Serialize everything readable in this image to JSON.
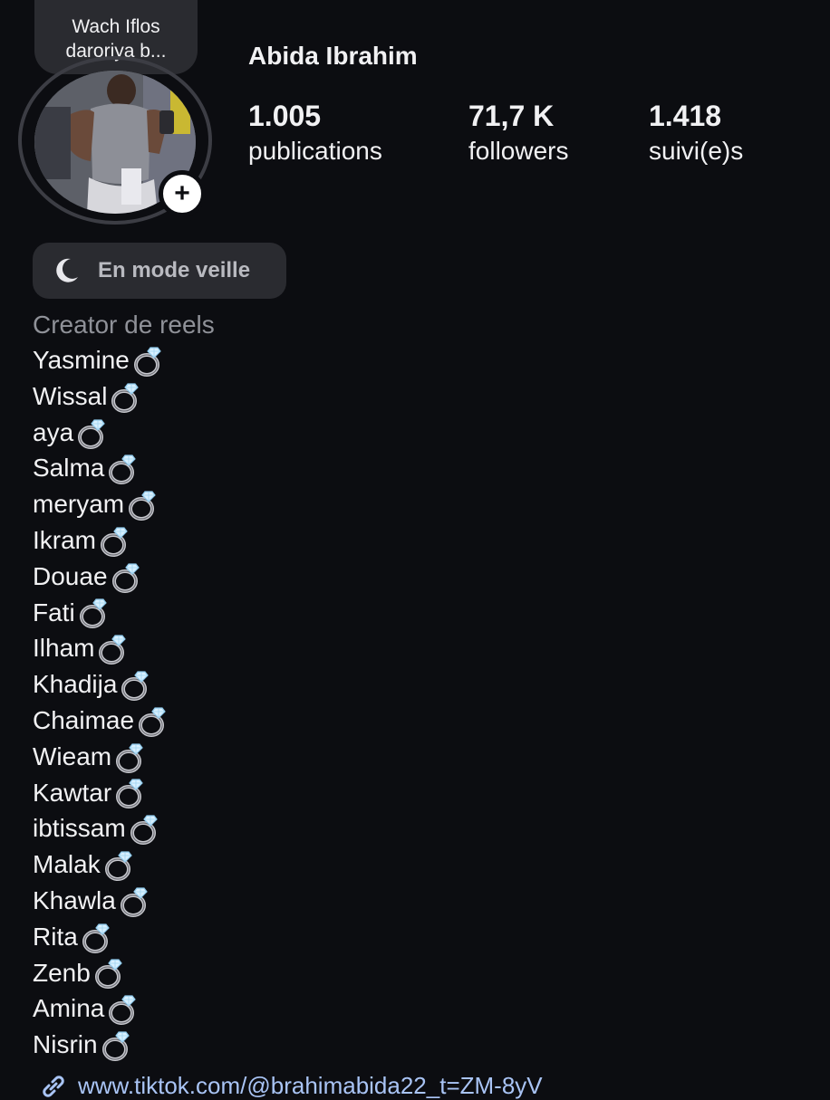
{
  "note": {
    "text": "Wach Iflos daroriya b..."
  },
  "profile": {
    "name": "Abida Ibrahim",
    "add_story_symbol": "+"
  },
  "stats": {
    "posts": {
      "value": "1.005",
      "label": "publications"
    },
    "followers": {
      "value": "71,7 K",
      "label": "followers"
    },
    "following": {
      "value": "1.418",
      "label": "suivi(e)s"
    }
  },
  "status": {
    "icon": "moon-icon",
    "label": "En mode veille"
  },
  "bio": {
    "category": "Creator de reels",
    "ring_icon": "ring-icon",
    "names": [
      "Yasmine",
      "Wissal",
      "aya",
      "Salma",
      "meryam",
      "Ikram",
      "Douae",
      "Fati",
      "Ilham",
      "Khadija",
      "Chaimae",
      "Wieam",
      "Kawtar",
      "ibtissam",
      "Malak",
      "Khawla",
      "Rita",
      "Zenb",
      "Amina",
      "Nisrin"
    ],
    "link": "www.tiktok.com/@brahimabida22_t=ZM-8yV"
  },
  "colors": {
    "background": "#0c0d11",
    "text": "#f1f1f3",
    "muted": "#8f9198",
    "pill": "#2a2b30",
    "link": "#a9c4f5"
  }
}
